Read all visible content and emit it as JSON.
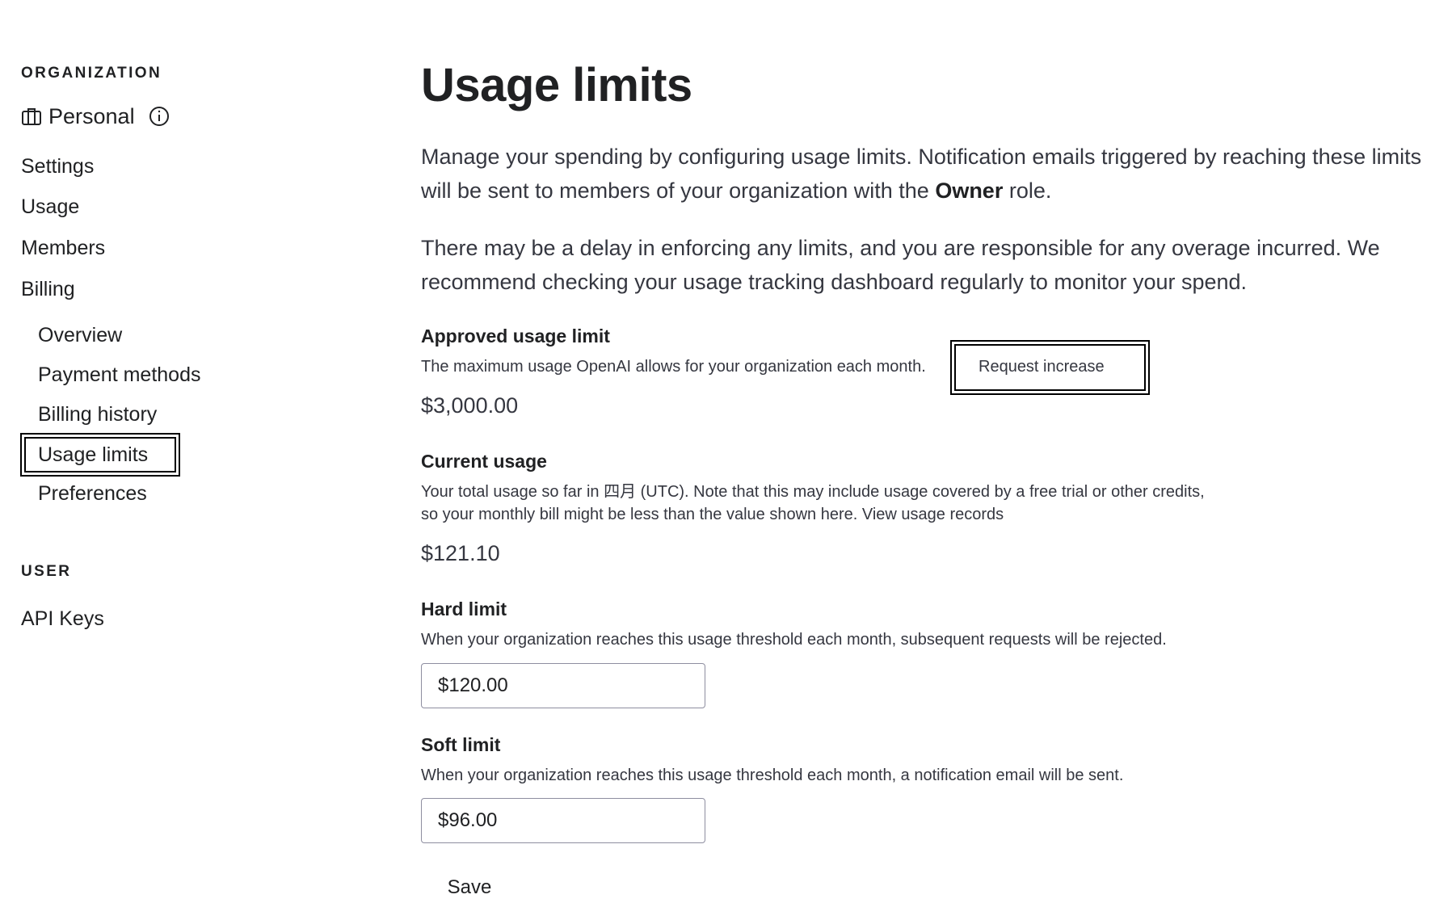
{
  "sidebar": {
    "org_heading": "ORGANIZATION",
    "org_name": "Personal",
    "items": {
      "settings": "Settings",
      "usage": "Usage",
      "members": "Members",
      "billing": "Billing"
    },
    "billing_sub": {
      "overview": "Overview",
      "payment_methods": "Payment methods",
      "billing_history": "Billing history",
      "usage_limits": "Usage limits",
      "preferences": "Preferences"
    },
    "user_heading": "USER",
    "api_keys": "API Keys"
  },
  "main": {
    "title": "Usage limits",
    "intro_1_pre": "Manage your spending by configuring usage limits. Notification emails triggered by reaching these limits will be sent to members of your organization with the ",
    "intro_1_bold": "Owner",
    "intro_1_post": " role.",
    "intro_2": "There may be a delay in enforcing any limits, and you are responsible for any overage incurred. We recommend checking your usage tracking dashboard regularly to monitor your spend.",
    "approved": {
      "heading": "Approved usage limit",
      "desc": "The maximum usage OpenAI allows for your organization each month.",
      "request_link": "Request increase",
      "value": "$3,000.00"
    },
    "current": {
      "heading": "Current usage",
      "desc_line1": "Your total usage so far in 四月 (UTC). Note that this may include usage covered by a free trial or other credits,",
      "desc_line2": "so your monthly bill might be less than the value shown here. View usage records",
      "value": "$121.10"
    },
    "hard": {
      "heading": "Hard limit",
      "desc": "When your organization reaches this usage threshold each month, subsequent requests will be rejected.",
      "value": "$120.00"
    },
    "soft": {
      "heading": "Soft limit",
      "desc": "When your organization reaches this usage threshold each month, a notification email will be sent.",
      "value": "$96.00"
    },
    "save_label": "Save"
  }
}
